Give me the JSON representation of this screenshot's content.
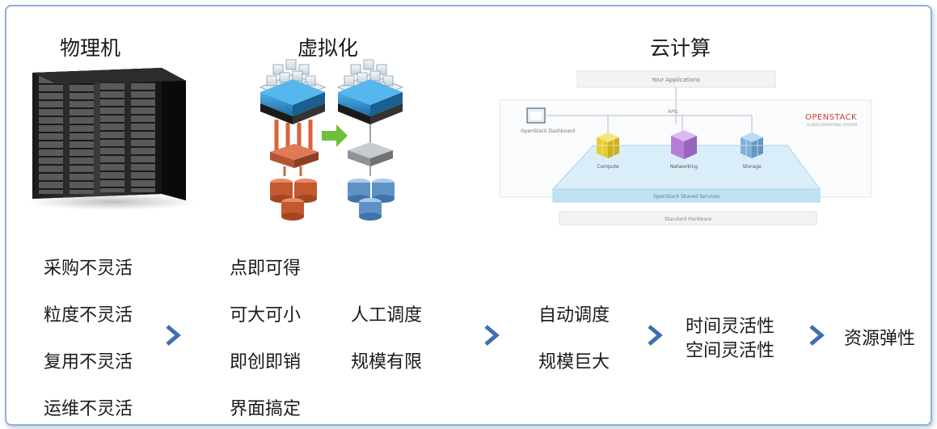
{
  "headings": {
    "physical": "物理机",
    "virtual": "虚拟化",
    "cloud": "云计算"
  },
  "physical_items": [
    "采购不灵活",
    "粒度不灵活",
    "复用不灵活",
    "运维不灵活"
  ],
  "virtual_items": [
    "点即可得",
    "可大可小",
    "即创即销",
    "界面搞定"
  ],
  "virtual_limits": [
    "人工调度",
    "规模有限"
  ],
  "cloud_items": [
    "自动调度",
    "规模巨大"
  ],
  "flex_items": [
    "时间灵活性",
    "空间灵活性"
  ],
  "result": "资源弹性",
  "openstack": {
    "logo": "OPENSTACK",
    "tagline": "CLOUD OPERATING SYSTEM",
    "apps": "Your Applications",
    "dashboard": "OpenStack Dashboard",
    "apis": "APIs",
    "compute": "Compute",
    "networking": "Networking",
    "storage": "Storage",
    "shared": "OpenStack Shared Services",
    "hardware": "Standard Hardware"
  },
  "colors": {
    "arrow": "#3f6fb0",
    "frame": "#8fb2d6",
    "compute": "#e8d64a",
    "networking": "#b57fd8",
    "storage": "#7fb2d8",
    "platform": "#bfe3f3",
    "openstack_red": "#d23a2a"
  }
}
